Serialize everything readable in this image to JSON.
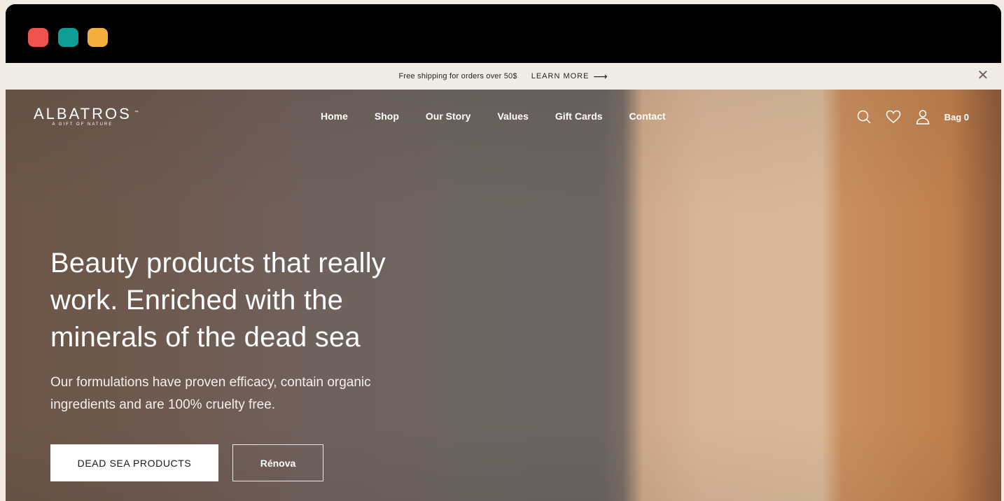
{
  "window": {
    "controls": [
      "close",
      "minimize",
      "maximize"
    ],
    "colors": {
      "close": "#ef5350",
      "minimize": "#0f9e95",
      "maximize": "#f4ae3d"
    }
  },
  "announcement": {
    "message": "Free shipping for orders over 50$",
    "link_label": "LEARN MORE",
    "link_icon": "arrow-right-icon",
    "close_icon": "close-icon"
  },
  "header": {
    "logo": {
      "brand": "ALBATROS",
      "trademark": "™",
      "tagline": "A GIFT OF NATURE"
    },
    "nav": [
      {
        "label": "Home"
      },
      {
        "label": "Shop"
      },
      {
        "label": "Our Story"
      },
      {
        "label": "Values"
      },
      {
        "label": "Gift Cards"
      },
      {
        "label": "Contact"
      }
    ],
    "tools": {
      "search_icon": "search-icon",
      "wishlist_icon": "heart-icon",
      "account_icon": "user-icon",
      "bag_label": "Bag 0"
    }
  },
  "hero": {
    "headline": "Beauty products that really work. Enriched with the minerals of the dead sea",
    "subtext": "Our formulations have proven efficacy, contain organic ingredients and are 100% cruelty free.",
    "primary_cta": "DEAD SEA PRODUCTS",
    "secondary_cta": "Rénova"
  },
  "colors": {
    "announcement_bg": "#f0ebe3",
    "text_on_hero": "#ffffff",
    "primary_button_bg": "#ffffff",
    "primary_button_text": "#1b1715"
  }
}
